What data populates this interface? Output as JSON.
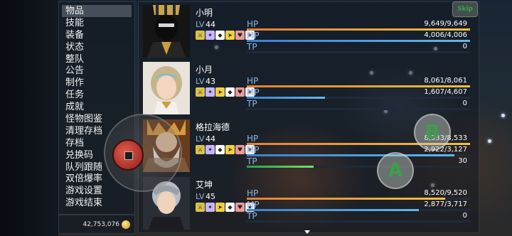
{
  "menu": {
    "items": [
      "物品",
      "技能",
      "装备",
      "状态",
      "整队",
      "公告",
      "制作",
      "任务",
      "成就",
      "怪物图鉴",
      "清理存档",
      "存档",
      "兑换码",
      "队列跟随",
      "双倍爆率",
      "游戏设置",
      "游戏结束"
    ],
    "selected_index": 0
  },
  "gold": {
    "amount": "42,753,076"
  },
  "status_labels": {
    "lv": "LV",
    "hp": "HP",
    "mp": "MP",
    "tp": "TP"
  },
  "actors": [
    {
      "name": "小明",
      "level": "44",
      "hp": "9,649/9,649",
      "mp": "4,006/4,006",
      "tp": "0",
      "hp_rate": 1.0,
      "mp_rate": 1.0,
      "tp_rate": 0.0
    },
    {
      "name": "小月",
      "level": "43",
      "hp": "8,061/8,061",
      "mp": "1,607/4,607",
      "tp": "0",
      "hp_rate": 1.0,
      "mp_rate": 0.35,
      "tp_rate": 0.0
    },
    {
      "name": "格拉海德",
      "level": "44",
      "hp": "8,533/8,533",
      "mp": "2,922/3,127",
      "tp": "30",
      "hp_rate": 1.0,
      "mp_rate": 0.93,
      "tp_rate": 0.3
    },
    {
      "name": "艾坤",
      "level": "45",
      "hp": "8,520/9,520",
      "mp": "2,877/3,717",
      "tp": "0",
      "hp_rate": 0.89,
      "mp_rate": 0.77,
      "tp_rate": 0.0
    }
  ],
  "controls": {
    "a_label": "A",
    "b_label": "B",
    "skip_label": "Skip"
  },
  "colors": {
    "hp": "#f0c040",
    "mp": "#60b8f0",
    "tp": "#70e070",
    "system": "#8fb4e6"
  }
}
